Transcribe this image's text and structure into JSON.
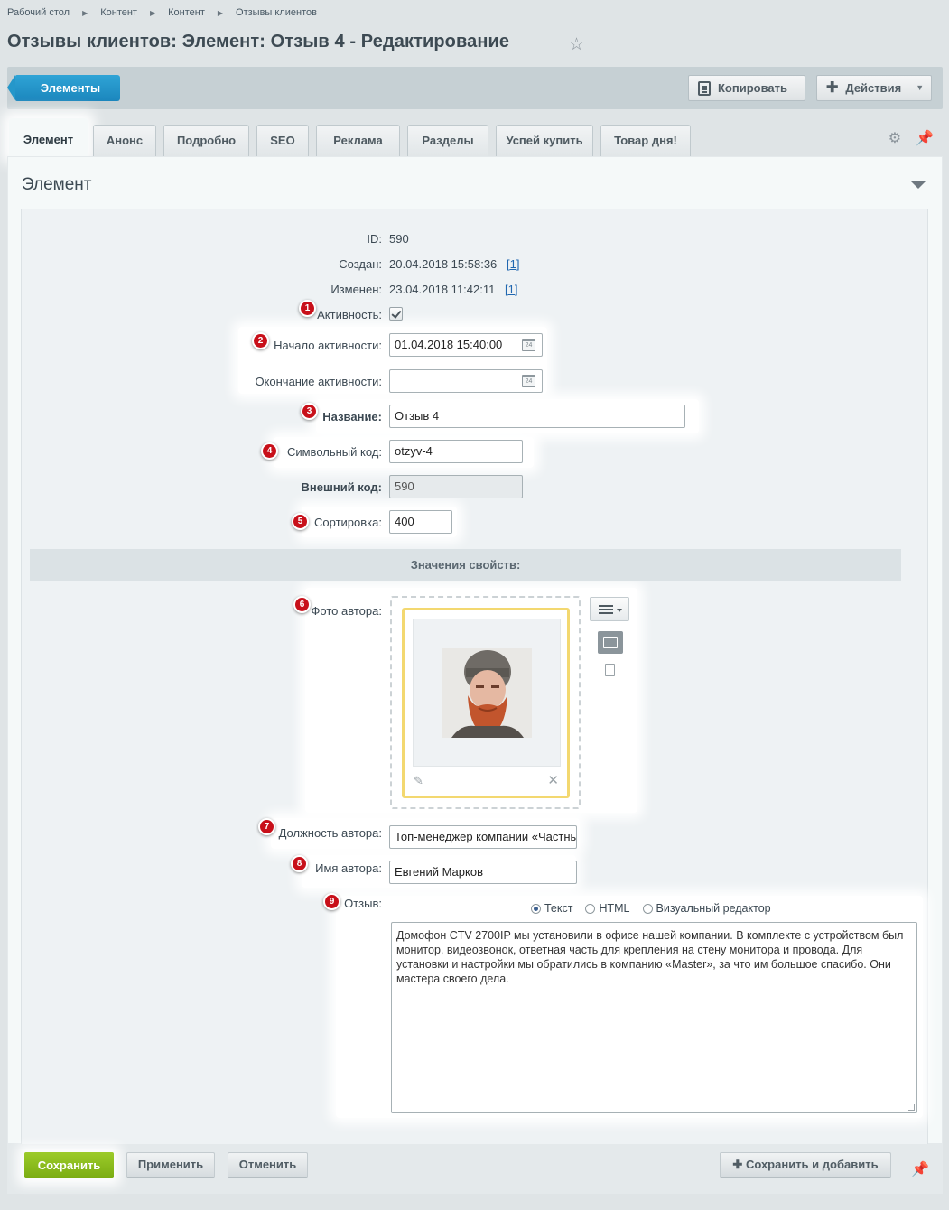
{
  "breadcrumb": [
    "Рабочий стол",
    "Контент",
    "Контент",
    "Отзывы клиентов"
  ],
  "page_title": "Отзывы клиентов: Элемент: Отзыв 4 - Редактирование",
  "toolbar": {
    "back_label": "Элементы",
    "copy_label": "Копировать",
    "actions_label": "Действия"
  },
  "tabs": [
    "Элемент",
    "Анонс",
    "Подробно",
    "SEO",
    "Реклама",
    "Разделы",
    "Успей купить",
    "Товар дня!"
  ],
  "panel_title": "Элемент",
  "fields": {
    "id_label": "ID:",
    "id_value": "590",
    "created_label": "Создан:",
    "created_value": "20.04.2018 15:58:36",
    "created_link": "[1]",
    "modified_label": "Изменен:",
    "modified_value": "23.04.2018 11:42:11",
    "modified_link": "[1]",
    "active_label": "Активность:",
    "start_label": "Начало активности:",
    "start_value": "01.04.2018 15:40:00",
    "end_label": "Окончание активности:",
    "end_value": "",
    "name_label": "Название:",
    "name_value": "Отзыв 4",
    "code_label": "Символьный код:",
    "code_value": "otzyv-4",
    "ext_label": "Внешний код:",
    "ext_value": "590",
    "sort_label": "Сортировка:",
    "sort_value": "400"
  },
  "props": {
    "section_title": "Значения свойств:",
    "photo_label": "Фото автора:",
    "position_label": "Должность автора:",
    "position_value": "Топ-менеджер компании «Частные",
    "author_label": "Имя автора:",
    "author_value": "Евгений Марков",
    "review_label": "Отзыв:",
    "modes": [
      "Текст",
      "HTML",
      "Визуальный редактор"
    ],
    "review_text": "Домофон CTV 2700IP мы установили в офисе нашей компании. В комплекте с устройством был монитор, видеозвонок, ответная часть для крепления на стену монитора и провода. Для установки и настройки мы обратились в компанию «Master», за что им большое спасибо. Они мастера своего дела."
  },
  "badges": [
    "1",
    "2",
    "3",
    "4",
    "5",
    "6",
    "7",
    "8",
    "9"
  ],
  "footer": {
    "save": "Сохранить",
    "apply": "Применить",
    "cancel": "Отменить",
    "save_add": "Сохранить и добавить"
  },
  "colors": {
    "accent_blue": "#1b86bd",
    "save_green": "#7aac12",
    "badge_red": "#c8101a",
    "highlight_yellow": "#f3d870"
  }
}
